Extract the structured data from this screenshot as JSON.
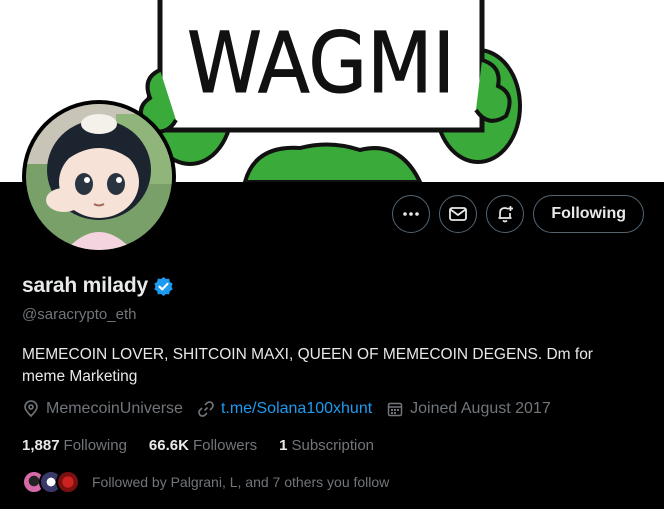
{
  "banner": {
    "sign_text": "WAGMI"
  },
  "profile": {
    "display_name": "sarah milady",
    "handle": "@saracrypto_eth",
    "bio": "MEMECOIN LOVER, SHITCOIN MAXI, QUEEN OF MEMECOIN DEGENS. Dm for meme Marketing",
    "location": "MemecoinUniverse",
    "website": "t.me/Solana100xhunt",
    "joined": "Joined August 2017"
  },
  "actions": {
    "more_icon": "more-icon",
    "message_icon": "mail-icon",
    "notify_icon": "bell-plus-icon",
    "follow_label": "Following"
  },
  "counts": {
    "following_value": "1,887",
    "following_label": "Following",
    "followers_value": "66.6K",
    "followers_label": "Followers",
    "subs_value": "1",
    "subs_label": "Subscription"
  },
  "followed_by": "Followed by Palgrani, L, and 7 others you follow",
  "colors": {
    "accent": "#1d9bf0",
    "verified": "#1d9bf0",
    "muted": "#71767b",
    "frog": "#3aaa3a"
  }
}
